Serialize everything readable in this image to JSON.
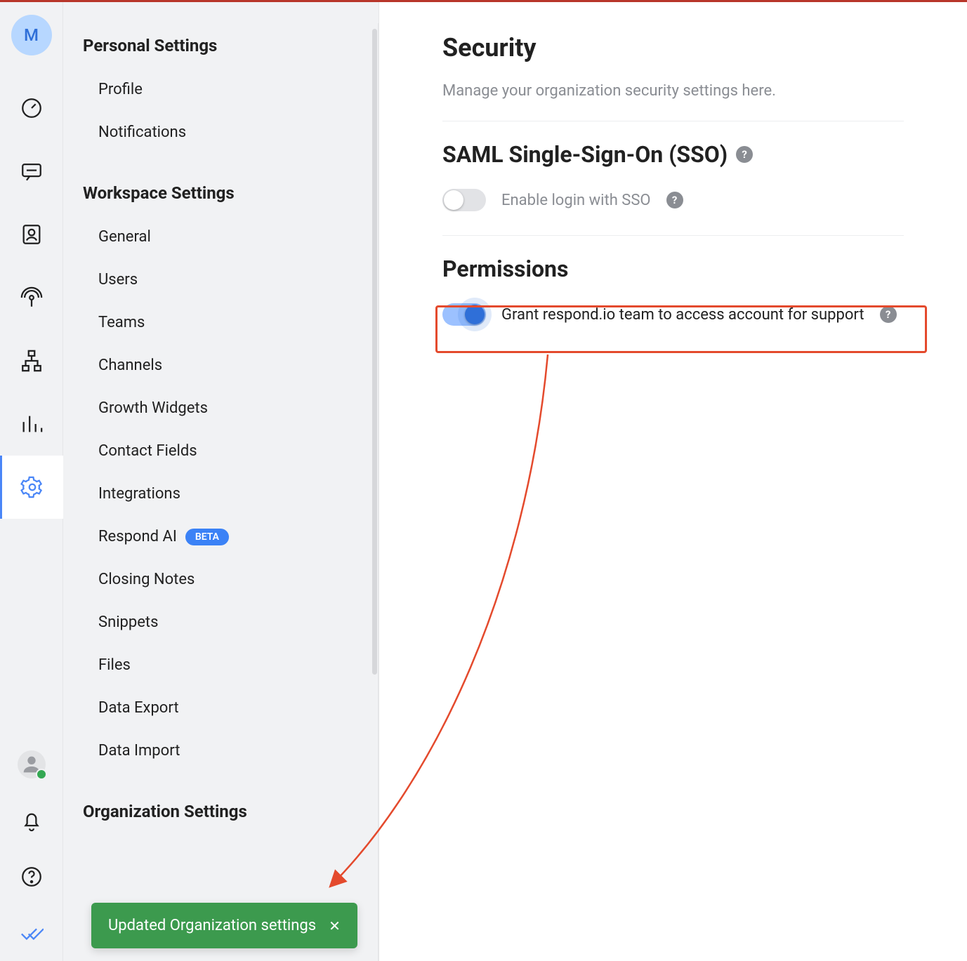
{
  "rail": {
    "avatar_letter": "M",
    "items": [
      {
        "name": "dashboard-icon"
      },
      {
        "name": "chat-icon"
      },
      {
        "name": "contacts-icon"
      },
      {
        "name": "broadcast-icon"
      },
      {
        "name": "workflow-icon"
      },
      {
        "name": "analytics-icon"
      },
      {
        "name": "settings-icon",
        "selected": true
      }
    ]
  },
  "sidenav": {
    "groups": [
      {
        "heading": "Personal Settings",
        "items": [
          {
            "label": "Profile"
          },
          {
            "label": "Notifications"
          }
        ]
      },
      {
        "heading": "Workspace Settings",
        "items": [
          {
            "label": "General"
          },
          {
            "label": "Users"
          },
          {
            "label": "Teams"
          },
          {
            "label": "Channels"
          },
          {
            "label": "Growth Widgets"
          },
          {
            "label": "Contact Fields"
          },
          {
            "label": "Integrations"
          },
          {
            "label": "Respond AI",
            "badge": "BETA"
          },
          {
            "label": "Closing Notes"
          },
          {
            "label": "Snippets"
          },
          {
            "label": "Files"
          },
          {
            "label": "Data Export"
          },
          {
            "label": "Data Import"
          }
        ]
      },
      {
        "heading": "Organization Settings",
        "items": []
      }
    ]
  },
  "main": {
    "page_title": "Security",
    "subtitle": "Manage your organization security settings here.",
    "sso": {
      "heading": "SAML Single-Sign-On (SSO)",
      "toggle_label": "Enable login with SSO",
      "enabled": false
    },
    "permissions": {
      "heading": "Permissions",
      "toggle_label": "Grant respond.io team to access account for support",
      "enabled": true
    }
  },
  "toast": {
    "text": "Updated Organization settings",
    "close": "✕"
  },
  "colors": {
    "accent": "#2f6fd8",
    "highlight": "#e44a2d",
    "success": "#3c9a4e"
  }
}
